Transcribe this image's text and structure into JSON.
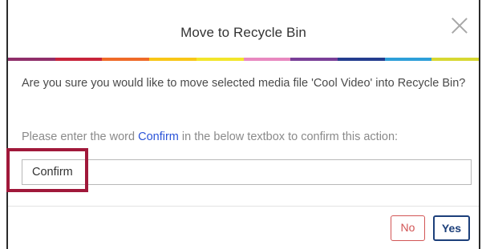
{
  "dialog": {
    "title": "Move to Recycle Bin",
    "close_icon": "close-icon",
    "message": "Are you sure you would like to move selected media file 'Cool Video' into Recycle Bin?",
    "hint": {
      "before": "Please enter the word",
      "keyword": "Confirm",
      "after": "in the below textbox to confirm this action:"
    },
    "input": {
      "value": "Confirm"
    },
    "buttons": {
      "no": "No",
      "yes": "Yes"
    }
  },
  "colors": {
    "stripe": [
      "#8f2f6a",
      "#c7233b",
      "#ef6a28",
      "#f8c617",
      "#f2e52b",
      "#e889c0",
      "#7a3f98",
      "#243d8e",
      "#2e9fd9",
      "#d7d832"
    ],
    "highlight": "#a0183a",
    "keyword": "#2a53d8",
    "no_button": "#d25555",
    "yes_button": "#1c3f7a"
  }
}
